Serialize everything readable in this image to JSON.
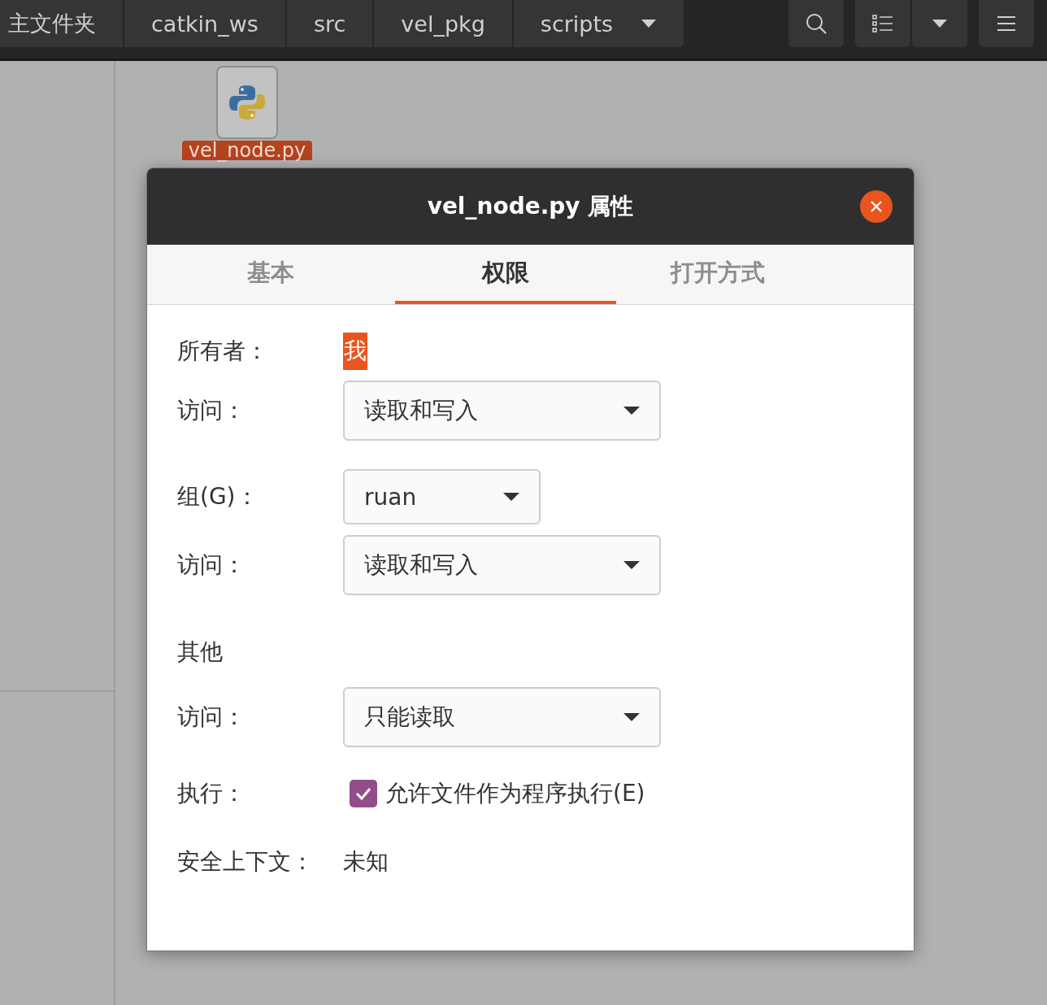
{
  "breadcrumbs": [
    {
      "label": "主文件夹",
      "dropdown": false
    },
    {
      "label": "catkin_ws",
      "dropdown": false
    },
    {
      "label": "src",
      "dropdown": false
    },
    {
      "label": "vel_pkg",
      "dropdown": false
    },
    {
      "label": "scripts",
      "dropdown": true
    }
  ],
  "file": {
    "name": "vel_node.py",
    "selected": true
  },
  "dialog": {
    "title": "vel_node.py 属性",
    "tabs": [
      {
        "label": "基本",
        "selected": false
      },
      {
        "label": "权限",
        "selected": true
      },
      {
        "label": "打开方式",
        "selected": false
      }
    ],
    "rows": [
      {
        "kind": "owner",
        "label": "所有者：",
        "value": "我"
      },
      {
        "kind": "select",
        "label": "访问：",
        "value": "读取和写入"
      },
      {
        "kind": "group",
        "label": "组(G)：",
        "value": "ruan"
      },
      {
        "kind": "select",
        "label": "访问：",
        "value": "读取和写入"
      },
      {
        "kind": "heading",
        "label": "其他"
      },
      {
        "kind": "select",
        "label": "访问：",
        "value": "只能读取"
      },
      {
        "kind": "checkbox",
        "label": "执行：",
        "value": "允许文件作为程序执行(E)",
        "checked": true
      },
      {
        "kind": "text",
        "label": "安全上下文：",
        "value": "未知"
      }
    ]
  }
}
